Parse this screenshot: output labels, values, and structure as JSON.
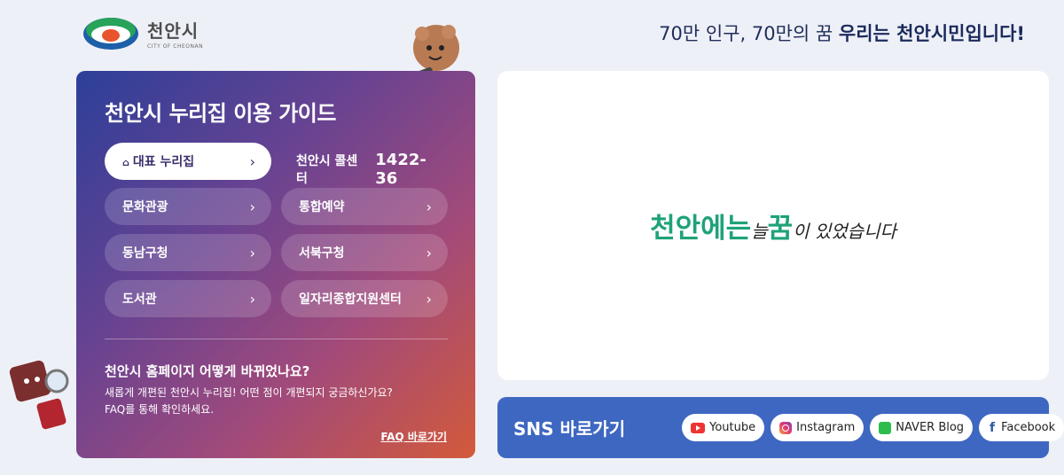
{
  "header": {
    "logo_ko": "천안시",
    "logo_en": "CITY OF CHEONAN",
    "slogan_prefix": "70만 인구, 70만의 꿈 ",
    "slogan_bold": "우리는 천안시민입니다!"
  },
  "guide": {
    "title": "천안시 누리집 이용 가이드",
    "buttons": [
      {
        "label": "대표 누리집"
      },
      {
        "label": "문화관광"
      },
      {
        "label": "통합예약"
      },
      {
        "label": "동남구청"
      },
      {
        "label": "서북구청"
      },
      {
        "label": "도서관"
      },
      {
        "label": "일자리종합지원센터"
      }
    ],
    "callcenter_label": "천안시 콜센터",
    "callcenter_number": "1422-36",
    "faq_title": "천안시 홈페이지 어떻게 바뀌었나요?",
    "faq_desc_1": "새롭게 개편된 천안시 누리집! 어떤 점이 개편되지 궁금하신가요?",
    "faq_desc_2": "FAQ를 통해 확인하세요.",
    "faq_link": "FAQ 바로가기"
  },
  "banner": {
    "text_1": "천안에는 ",
    "text_2": "늘 ",
    "text_3": "꿈",
    "text_4": "이 있었습니다"
  },
  "sns": {
    "title": "SNS 바로가기",
    "items": [
      {
        "label": "Youtube",
        "icon": "youtube-icon"
      },
      {
        "label": "Instagram",
        "icon": "instagram-icon"
      },
      {
        "label": "NAVER Blog",
        "icon": "naver-blog-icon"
      },
      {
        "label": "Facebook",
        "icon": "facebook-icon"
      }
    ]
  },
  "colors": {
    "background": "#eef0f7",
    "banner_green": "#1ea27a",
    "sns_blue": "#3e67c2",
    "slogan_navy": "#1f2d5a"
  }
}
